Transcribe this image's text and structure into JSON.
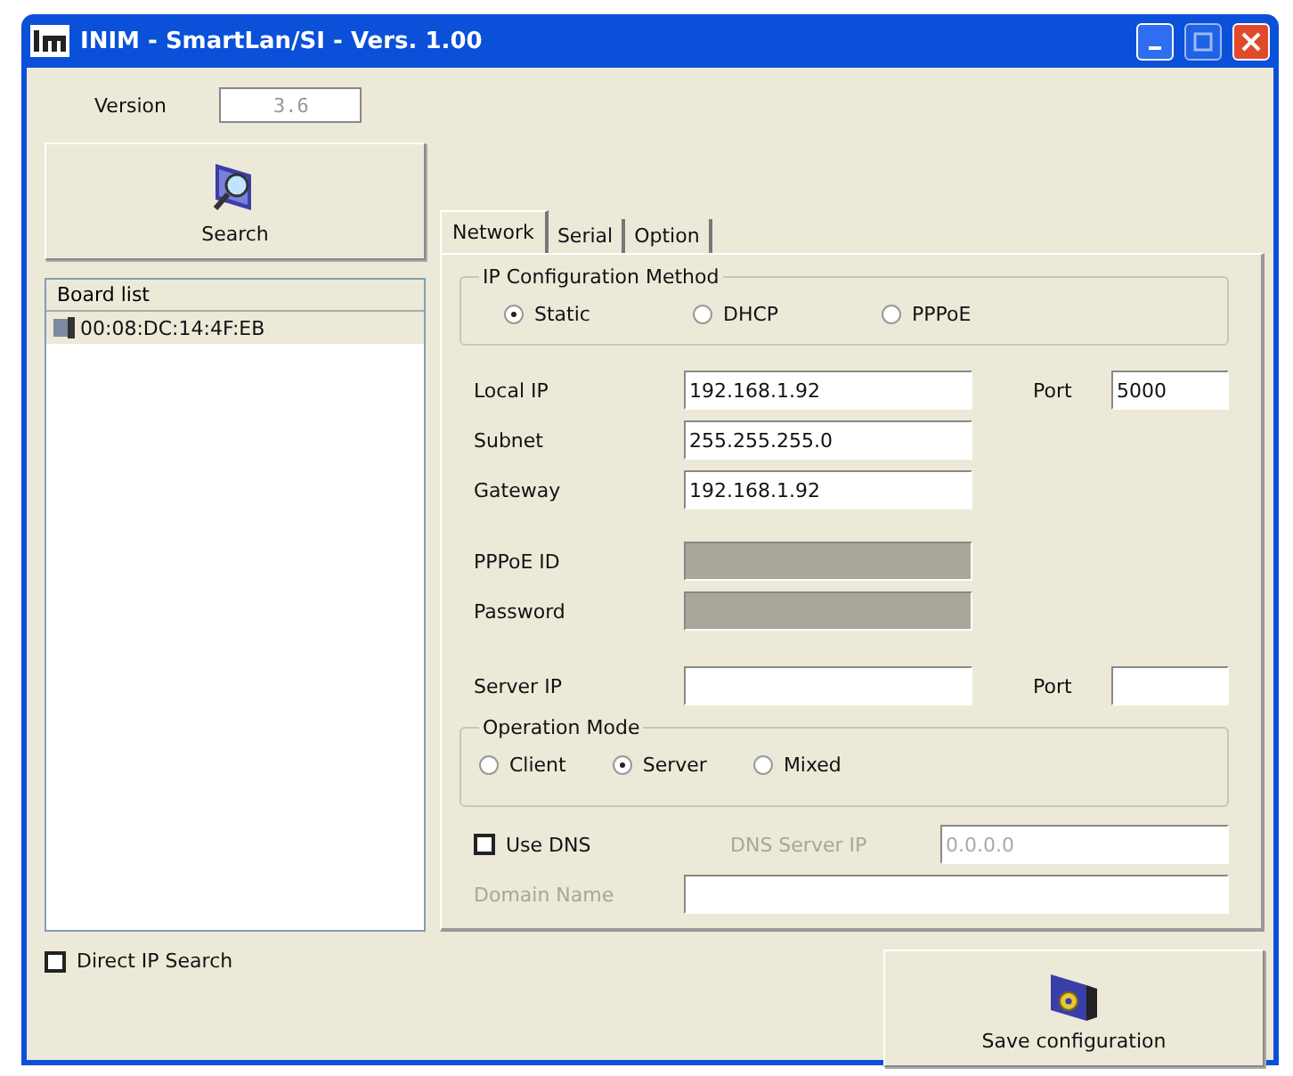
{
  "window": {
    "title": "INIM - SmartLan/SI - Vers. 1.00"
  },
  "version": {
    "label": "Version",
    "value": "3.6"
  },
  "search_button": {
    "label": "Search"
  },
  "board_list": {
    "header": "Board list",
    "items": [
      {
        "label": "00:08:DC:14:4F:EB",
        "selected": false
      }
    ]
  },
  "direct_ip_search": {
    "label": "Direct IP Search",
    "checked": false
  },
  "tabs": [
    {
      "label": "Network",
      "selected": true
    },
    {
      "label": "Serial",
      "selected": false
    },
    {
      "label": "Option",
      "selected": false
    }
  ],
  "ip_config": {
    "title": "IP Configuration Method",
    "options": [
      {
        "label": "Static",
        "selected": true
      },
      {
        "label": "DHCP",
        "selected": false
      },
      {
        "label": "PPPoE",
        "selected": false
      }
    ]
  },
  "address_fields": [
    {
      "label": "Local IP",
      "value": "192.168.1.92",
      "port": {
        "label": "Port",
        "value": "5000"
      }
    },
    {
      "label": "Subnet",
      "value": "255.255.255.0"
    },
    {
      "label": "Gateway",
      "value": "192.168.1.92"
    }
  ],
  "pppoe_fields": [
    {
      "label": "PPPoE ID",
      "disabled": true
    },
    {
      "label": "Password",
      "disabled": true
    }
  ],
  "server_fields": [
    {
      "label": "Server IP",
      "port": {
        "label": "Port"
      }
    }
  ],
  "operation_mode": {
    "title": "Operation Mode",
    "options": [
      {
        "label": "Client",
        "selected": false
      },
      {
        "label": "Server",
        "selected": true
      },
      {
        "label": "Mixed",
        "selected": false
      }
    ]
  },
  "use_dns": {
    "label": "Use DNS",
    "checked": false
  },
  "dns_server_ip": {
    "label": "DNS Server IP",
    "value": "0.0.0.0",
    "disabled": true
  },
  "domain_name": {
    "label": "Domain Name",
    "disabled": true
  },
  "save_button": {
    "label": "Save configuration"
  }
}
